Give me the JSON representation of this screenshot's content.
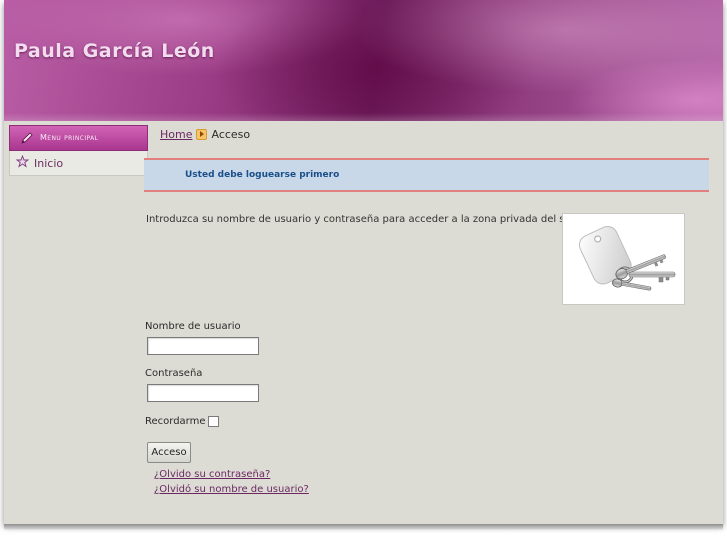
{
  "header": {
    "site_title": "Paula García León"
  },
  "sidebar": {
    "menu_title": "Menu principal",
    "items": [
      {
        "label": "Inicio",
        "icon": "star-icon"
      }
    ]
  },
  "breadcrumb": {
    "home": "Home",
    "current": "Acceso"
  },
  "notice": {
    "text": "Usted debe loguearse primero"
  },
  "login": {
    "intro": "Introduzca su nombre de usuario y contraseña para acceder a la zona privada del sitio",
    "username_label": "Nombre de usuario",
    "username_value": "",
    "password_label": "Contraseña",
    "password_value": "",
    "remember_label": "Recordarme",
    "remember_checked": false,
    "submit_label": "Acceso",
    "forgot_password": "¿Olvido su contraseña?",
    "forgot_username": "¿Olvidó su nombre de usuario?"
  },
  "colors": {
    "accent": "#a9368f",
    "link": "#6b2862",
    "notice_bg": "#c8d8e8",
    "notice_border": "#e28080",
    "page_bg": "#dcdcd4"
  }
}
